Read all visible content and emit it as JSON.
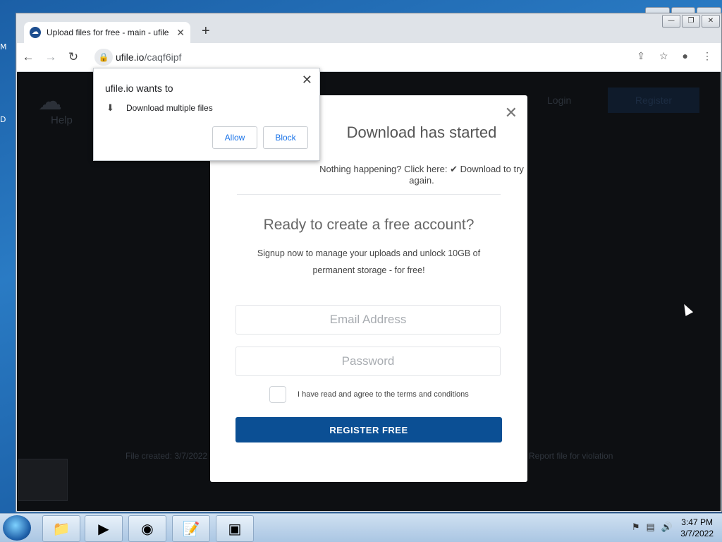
{
  "desktop": {
    "label_m": "M",
    "label_d": "D"
  },
  "browser": {
    "tab": {
      "title": "Upload files for free - main - ufile",
      "close_glyph": "✕"
    },
    "new_tab_glyph": "+",
    "toolbar": {
      "back": "←",
      "forward": "→",
      "reload": "↻"
    },
    "address": {
      "host": "ufile.io",
      "path": "/caqf6ipf"
    },
    "window_controls": [
      "—",
      "❐",
      "✕"
    ]
  },
  "page": {
    "help": "Help",
    "login": "Login",
    "register": "Register",
    "footer_left": "File created: 3/7/2022",
    "footer_right": "Report file for violation"
  },
  "modal": {
    "heading": "Download has started",
    "retry_text": "Nothing happening? Click here: ✔ Download to try again.",
    "title": "Ready to create a free account?",
    "description": "Signup now to manage your uploads and unlock 10GB of permanent storage - for free!",
    "email_placeholder": "Email Address",
    "password_placeholder": "Password",
    "terms": "I have read and agree to the terms and conditions",
    "register_button": "REGISTER FREE",
    "close_glyph": "✕"
  },
  "permission_popup": {
    "title": "ufile.io wants to",
    "item": "Download multiple files",
    "allow": "Allow",
    "block": "Block",
    "close_glyph": "✕"
  },
  "taskbar": {
    "time": "3:47 PM",
    "date": "3/7/2022"
  }
}
